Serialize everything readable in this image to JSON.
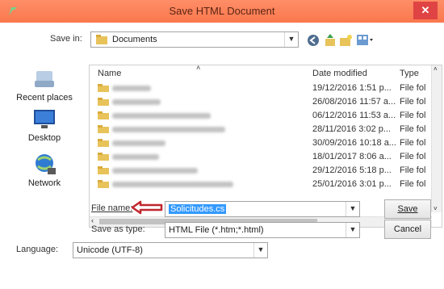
{
  "window": {
    "title": "Save HTML Document",
    "close": "✕"
  },
  "save_in": {
    "label": "Save in:",
    "value": "Documents"
  },
  "places": [
    {
      "label": "Recent places",
      "icon": "recent-places-icon"
    },
    {
      "label": "Desktop",
      "icon": "desktop-icon"
    },
    {
      "label": "Network",
      "icon": "network-icon"
    }
  ],
  "columns": {
    "name": "Name",
    "date": "Date modified",
    "type": "Type"
  },
  "files": [
    {
      "date": "19/12/2016 1:51 p...",
      "type": "File fol"
    },
    {
      "date": "26/08/2016 11:57 a...",
      "type": "File fol"
    },
    {
      "date": "06/12/2016 11:53 a...",
      "type": "File fol"
    },
    {
      "date": "28/11/2016 3:02 p...",
      "type": "File fol"
    },
    {
      "date": "30/09/2016 10:18 a...",
      "type": "File fol"
    },
    {
      "date": "18/01/2017 8:06 a...",
      "type": "File fol"
    },
    {
      "date": "29/12/2016 5:18 p...",
      "type": "File fol"
    },
    {
      "date": "25/01/2016 3:01 p...",
      "type": "File fol"
    }
  ],
  "file_name": {
    "label": "File name:",
    "value": "Solicitudes.cs"
  },
  "save_as_type": {
    "label": "Save as type:",
    "value": "HTML File (*.htm;*.html)"
  },
  "language": {
    "label": "Language:",
    "value": "Unicode (UTF-8)"
  },
  "buttons": {
    "save": "Save",
    "cancel": "Cancel"
  },
  "colors": {
    "titlebar": "#f9774d",
    "close": "#e04343",
    "arrow": "#c0272d",
    "selection": "#3399ff"
  }
}
